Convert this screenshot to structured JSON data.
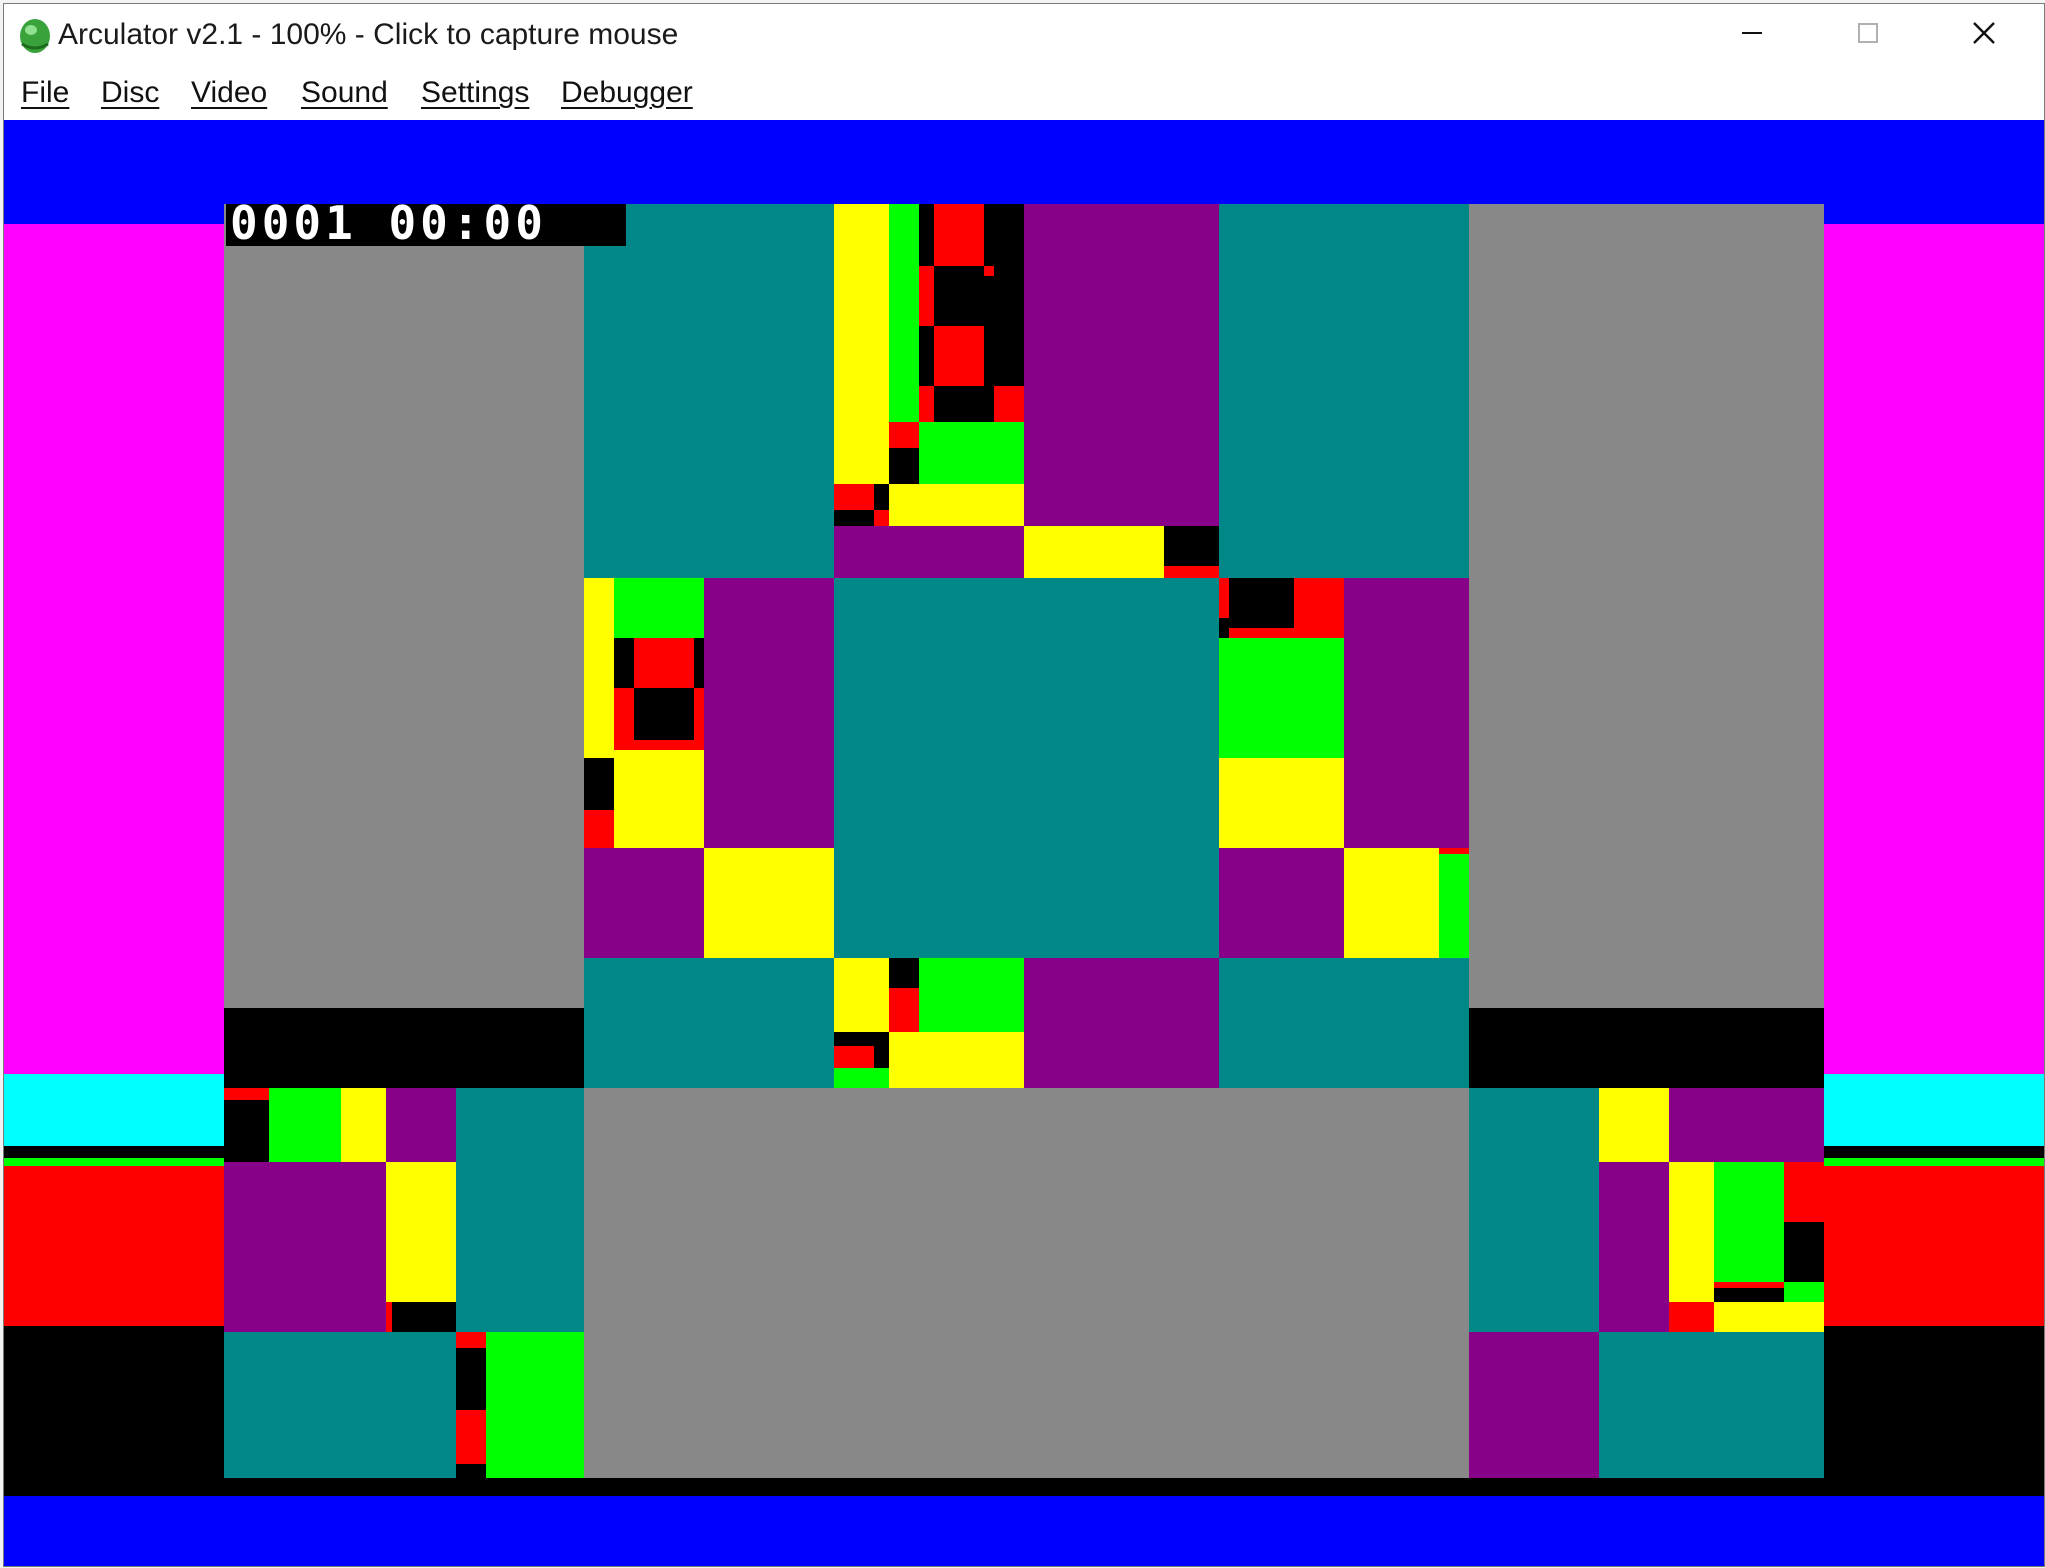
{
  "window": {
    "title": "Arculator v2.1 - 100% - Click to capture mouse",
    "app_icon": "arculator-app-icon",
    "controls": {
      "minimize_icon": "minimize-icon",
      "maximize_icon": "maximize-icon",
      "close_icon": "close-icon"
    }
  },
  "menu": {
    "items": [
      {
        "label": "File"
      },
      {
        "label": "Disc"
      },
      {
        "label": "Video"
      },
      {
        "label": "Sound"
      },
      {
        "label": "Settings"
      },
      {
        "label": "Debugger"
      }
    ]
  },
  "emulator": {
    "overlay_text": "0001 00:00",
    "palette": {
      "blue": "#0000ff",
      "magenta": "#ff00ff",
      "cyan": "#00ffff",
      "red": "#ff0000",
      "green": "#00ff00",
      "yellow": "#ffff00",
      "black": "#000000",
      "grey": "#888888",
      "teal": "#008888",
      "purple": "#880088"
    }
  }
}
